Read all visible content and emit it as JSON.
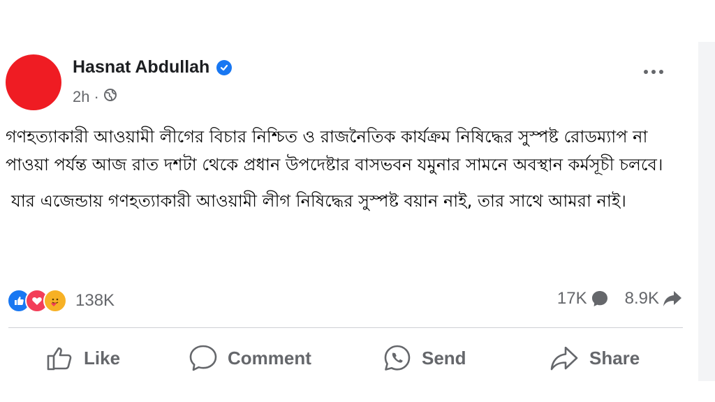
{
  "post": {
    "author": "Hasnat Abdullah",
    "verified": true,
    "time": "2h",
    "audience_icon": "globe-icon",
    "more_icon": "more-options-icon",
    "paragraphs": [
      "গণহত্যাকারী আওয়ামী লীগের বিচার নিশ্চিত ও রাজনৈতিক কার্যক্রম নিষিদ্ধের সুস্পষ্ট রোডম্যাপ না পাওয়া পর্যন্ত আজ রাত দশটা থেকে প্রধান উপদেষ্টার বাসভবন যমুনার সামনে অবস্থান কর্মসূচী চলবে।",
      "যার এজেন্ডায় গণহত্যাকারী আওয়ামী লীগ নিষিদ্ধের সুস্পষ্ট বয়ান নাই, তার সাথে আমরা নাই।"
    ],
    "avatar_color": "#ef1c23"
  },
  "reactions": {
    "icons": [
      "like-reaction-icon",
      "love-reaction-icon",
      "care-reaction-icon"
    ],
    "count": "138K"
  },
  "stats": {
    "comments": "17K",
    "shares": "8.9K"
  },
  "actions": {
    "like": "Like",
    "comment": "Comment",
    "send": "Send",
    "share": "Share"
  },
  "colors": {
    "brand_blue": "#1877f2",
    "love_red": "#f33e58",
    "care_yellow": "#f7b125",
    "secondary_text": "#65676b",
    "primary_text": "#050505"
  }
}
